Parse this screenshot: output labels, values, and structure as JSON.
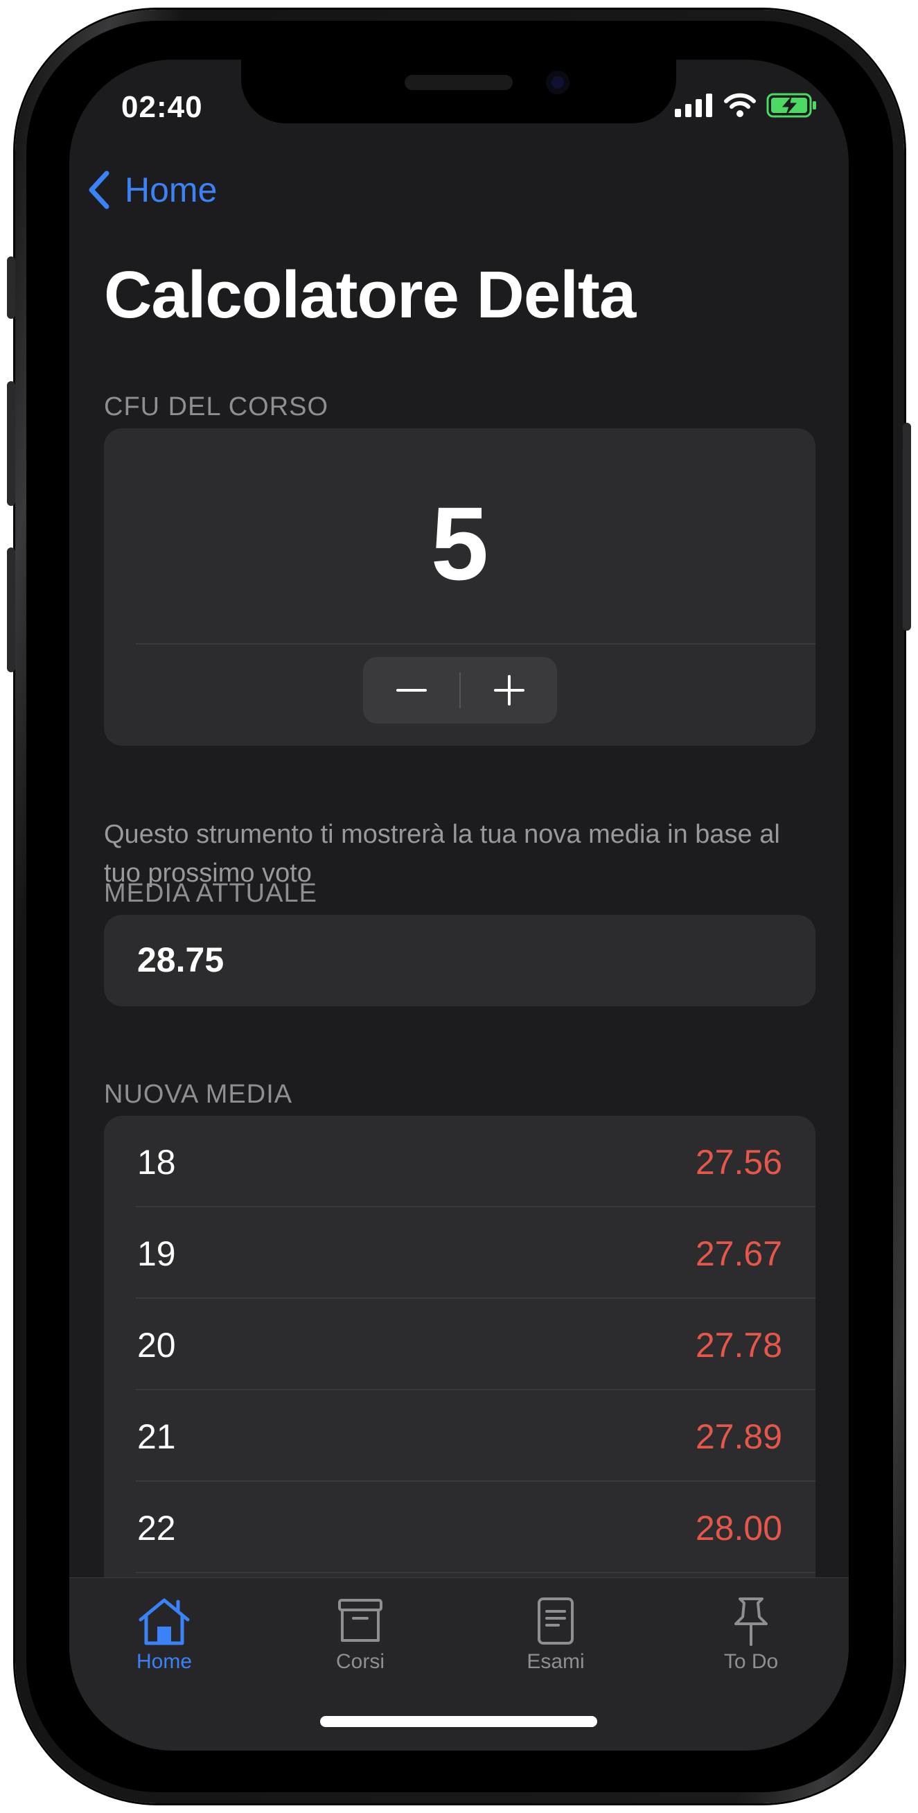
{
  "status_bar": {
    "time": "02:40"
  },
  "nav": {
    "back_label": "Home"
  },
  "page": {
    "title": "Calcolatore Delta"
  },
  "cfu_section": {
    "header": "CFU DEL CORSO",
    "value": "5",
    "footer": "Questo strumento ti mostrerà la tua nova media in base al tuo prossimo voto"
  },
  "media_attuale": {
    "header": "MEDIA ATTUALE",
    "value": "28.75"
  },
  "nuova_media": {
    "header": "NUOVA MEDIA",
    "rows": [
      {
        "grade": "18",
        "average": "27.56"
      },
      {
        "grade": "19",
        "average": "27.67"
      },
      {
        "grade": "20",
        "average": "27.78"
      },
      {
        "grade": "21",
        "average": "27.89"
      },
      {
        "grade": "22",
        "average": "28.00"
      }
    ]
  },
  "tab_bar": {
    "tabs": [
      {
        "label": "Home",
        "icon": "house-icon",
        "active": true
      },
      {
        "label": "Corsi",
        "icon": "archive-box-icon",
        "active": false
      },
      {
        "label": "Esami",
        "icon": "document-icon",
        "active": false
      },
      {
        "label": "To Do",
        "icon": "pin-icon",
        "active": false
      }
    ]
  },
  "colors": {
    "accent": "#3b82f6",
    "negative": "#e5574b",
    "background": "#1c1c1e",
    "card": "#2c2c2e",
    "battery": "#4cd964"
  }
}
